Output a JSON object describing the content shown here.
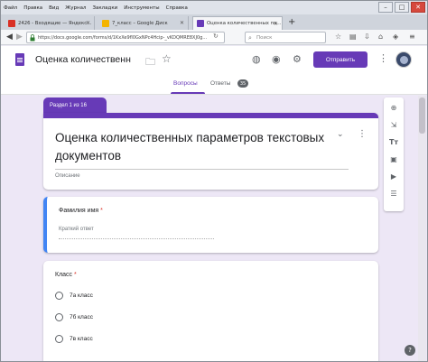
{
  "menubar": {
    "items": [
      "Файл",
      "Правка",
      "Вид",
      "Журнал",
      "Закладки",
      "Инструменты",
      "Справка"
    ]
  },
  "tabs": [
    {
      "label": "2426 - Входящие — Яндекс…",
      "icon": "gmail-icon",
      "color": "#d93025"
    },
    {
      "label": "7_класс – Google Диск",
      "icon": "drive-icon",
      "color": "#f4b400"
    },
    {
      "label": "Оценка количественных па…",
      "icon": "forms-icon",
      "color": "#673ab7"
    }
  ],
  "navbar": {
    "url": "https://docs.google.com/forms/d/1KxXe9fl0GxNPc4Hcip-_vKDQMRE8XJ0g…",
    "search_placeholder": "Поиск"
  },
  "header": {
    "title": "Оценка количественн",
    "send_label": "Отправить",
    "tabs": {
      "questions": "Вопросы",
      "answers": "Ответы"
    },
    "answers_count": "35"
  },
  "colors": {
    "brand": "#673ab7",
    "required": "#d93025",
    "active_question": "#4285f4"
  },
  "form": {
    "section_label": "Раздел 1 из 16",
    "title": "Оценка количественных параметров текстовых документов",
    "description_placeholder": "Описание",
    "questions": [
      {
        "label": "Фамилия имя",
        "required": "*",
        "placeholder": "Краткий ответ"
      },
      {
        "label": "Класс",
        "required": "*",
        "options": [
          "7а класс",
          "7б класс",
          "7в класс"
        ]
      }
    ]
  }
}
